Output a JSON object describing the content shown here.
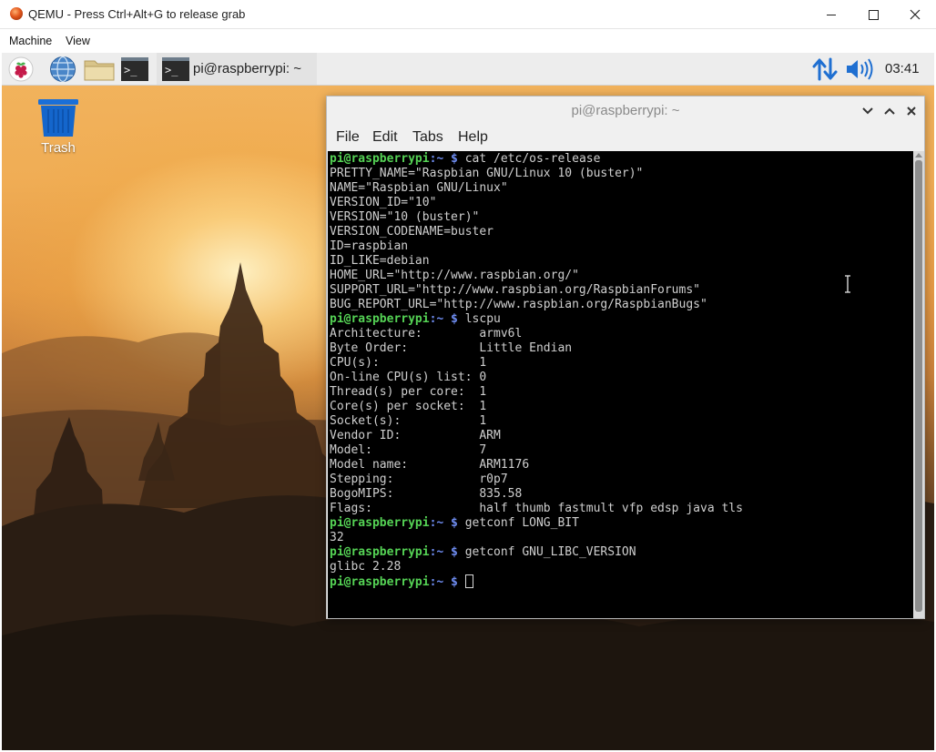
{
  "host": {
    "title": "QEMU - Press Ctrl+Alt+G to release grab",
    "menu": [
      "Machine",
      "View"
    ]
  },
  "panel": {
    "task_label": "pi@raspberrypi: ~",
    "clock": "03:41",
    "icons": [
      "raspberry-menu-icon",
      "web-browser-icon",
      "file-manager-icon",
      "terminal-icon",
      "network-icon",
      "volume-icon"
    ]
  },
  "desktop": {
    "trash_label": "Trash"
  },
  "terminal": {
    "title": "pi@raspberrypi: ~",
    "menu": [
      "File",
      "Edit",
      "Tabs",
      "Help"
    ],
    "prompt_user": "pi@raspberrypi",
    "prompt_path": ":~ $",
    "lines": [
      {
        "prompt": true,
        "cmd": " cat /etc/os-release"
      },
      {
        "text": "PRETTY_NAME=\"Raspbian GNU/Linux 10 (buster)\""
      },
      {
        "text": "NAME=\"Raspbian GNU/Linux\""
      },
      {
        "text": "VERSION_ID=\"10\""
      },
      {
        "text": "VERSION=\"10 (buster)\""
      },
      {
        "text": "VERSION_CODENAME=buster"
      },
      {
        "text": "ID=raspbian"
      },
      {
        "text": "ID_LIKE=debian"
      },
      {
        "text": "HOME_URL=\"http://www.raspbian.org/\""
      },
      {
        "text": "SUPPORT_URL=\"http://www.raspbian.org/RaspbianForums\""
      },
      {
        "text": "BUG_REPORT_URL=\"http://www.raspbian.org/RaspbianBugs\""
      },
      {
        "prompt": true,
        "cmd": " lscpu"
      },
      {
        "text": "Architecture:        armv6l"
      },
      {
        "text": "Byte Order:          Little Endian"
      },
      {
        "text": "CPU(s):              1"
      },
      {
        "text": "On-line CPU(s) list: 0"
      },
      {
        "text": "Thread(s) per core:  1"
      },
      {
        "text": "Core(s) per socket:  1"
      },
      {
        "text": "Socket(s):           1"
      },
      {
        "text": "Vendor ID:           ARM"
      },
      {
        "text": "Model:               7"
      },
      {
        "text": "Model name:          ARM1176"
      },
      {
        "text": "Stepping:            r0p7"
      },
      {
        "text": "BogoMIPS:            835.58"
      },
      {
        "text": "Flags:               half thumb fastmult vfp edsp java tls"
      },
      {
        "prompt": true,
        "cmd": " getconf LONG_BIT"
      },
      {
        "text": "32"
      },
      {
        "prompt": true,
        "cmd": " getconf GNU_LIBC_VERSION"
      },
      {
        "text": "glibc 2.28"
      },
      {
        "prompt": true,
        "cmd": " ",
        "cursor": true
      }
    ]
  },
  "colors": {
    "prompt_user": "#55d355",
    "prompt_path": "#6e8cf0",
    "terminal_bg": "#000000",
    "terminal_fg": "#cfcfcf",
    "network_icon": "#1f6fd1",
    "volume_icon": "#1f6fd1"
  }
}
